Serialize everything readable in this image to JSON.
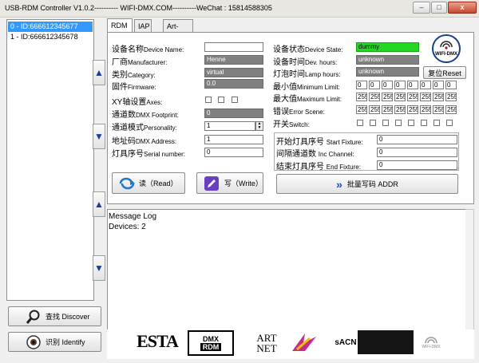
{
  "window": {
    "title": "USB-RDM Controller V1.0.2---------- WIFI-DMX.COM----------WeChat : 15814588305",
    "minimize": "–",
    "maximize": "□",
    "close": "x"
  },
  "devices": [
    "0 - ID:666612345677",
    "1 - ID:666612345678"
  ],
  "tabs": [
    "RDM",
    "IAP",
    "Art-Net"
  ],
  "left_fields": [
    {
      "label_cn": "设备名称",
      "label_en": "Device Name:",
      "value": ""
    },
    {
      "label_cn": "厂商",
      "label_en": "Manufacturer:",
      "value": "Henne"
    },
    {
      "label_cn": "类别",
      "label_en": "Category:",
      "value": "virtual"
    },
    {
      "label_cn": "固件",
      "label_en": "Firmware:",
      "value": "0.0"
    }
  ],
  "xy_axes": {
    "label_cn": "XY轴设置",
    "label_en": "Axes:"
  },
  "footprint": {
    "label_cn": "通道数",
    "label_en": "DMX Footprint:",
    "value": "0"
  },
  "personality": {
    "label_cn": "通道模式",
    "label_en": "Personality:",
    "value": "1"
  },
  "dmx_address": {
    "label_cn": "地址码",
    "label_en": "DMX Address:",
    "value": "1"
  },
  "serial_number": {
    "label_cn": "灯具序号",
    "label_en": "Serial number:",
    "value": "0"
  },
  "read_button": "读（Read）",
  "write_button": "写（Write）",
  "device_state": {
    "label_cn": "设备状态",
    "label_en": "Device State:",
    "value": "dummy"
  },
  "dev_hours": {
    "label_cn": "设备时间",
    "label_en": "Dev. hours:",
    "value": "unknown"
  },
  "lamp_hours": {
    "label_cn": "灯泡时间",
    "label_en": "Lamp hours:",
    "value": "unknown"
  },
  "reset_button": "复位Reset",
  "min_limit": {
    "label_cn": "最小值",
    "label_en": "Minimum Limit:",
    "values": [
      "0",
      "0",
      "0",
      "0",
      "0",
      "0",
      "0",
      "0"
    ]
  },
  "max_limit": {
    "label_cn": "最大值",
    "label_en": "Maximum Limit:",
    "values": [
      "255",
      "255",
      "255",
      "255",
      "255",
      "255",
      "255",
      "255"
    ]
  },
  "error_scene": {
    "label_cn": "错误",
    "label_en": "Error Scene:",
    "values": [
      "255",
      "255",
      "255",
      "255",
      "255",
      "255",
      "255",
      "255"
    ]
  },
  "switch": {
    "label_cn": "开关",
    "label_en": "Switch:"
  },
  "batch": {
    "start_fixture": {
      "label_cn": "开始灯具序号",
      "label_en": "Start Fixture:",
      "value": "0"
    },
    "inc_channel": {
      "label_cn": "间隔通道数",
      "label_en": "Inc Channel:",
      "value": "0"
    },
    "end_fixture": {
      "label_cn": "结束灯具序号",
      "label_en": "End Fixture:",
      "value": "0"
    },
    "button": "批量写码 ADDR"
  },
  "log": {
    "title": "Message Log",
    "devices_line": "Devices: 2"
  },
  "discover_button": "查找 Discover",
  "identify_button": "识别 Identify",
  "logos": {
    "wifi_dmx": "WIFI-DMX",
    "esta": "ESTA",
    "dmx": "DMX",
    "rdm": "RDM",
    "artnet_1": "ART",
    "artnet_2": "NET",
    "sacn": "sACN",
    "wifi_small": "WIFI-DMX"
  },
  "colors": {
    "accent": "#3399ff",
    "green_state": "#22d822",
    "readonly": "#808080"
  }
}
